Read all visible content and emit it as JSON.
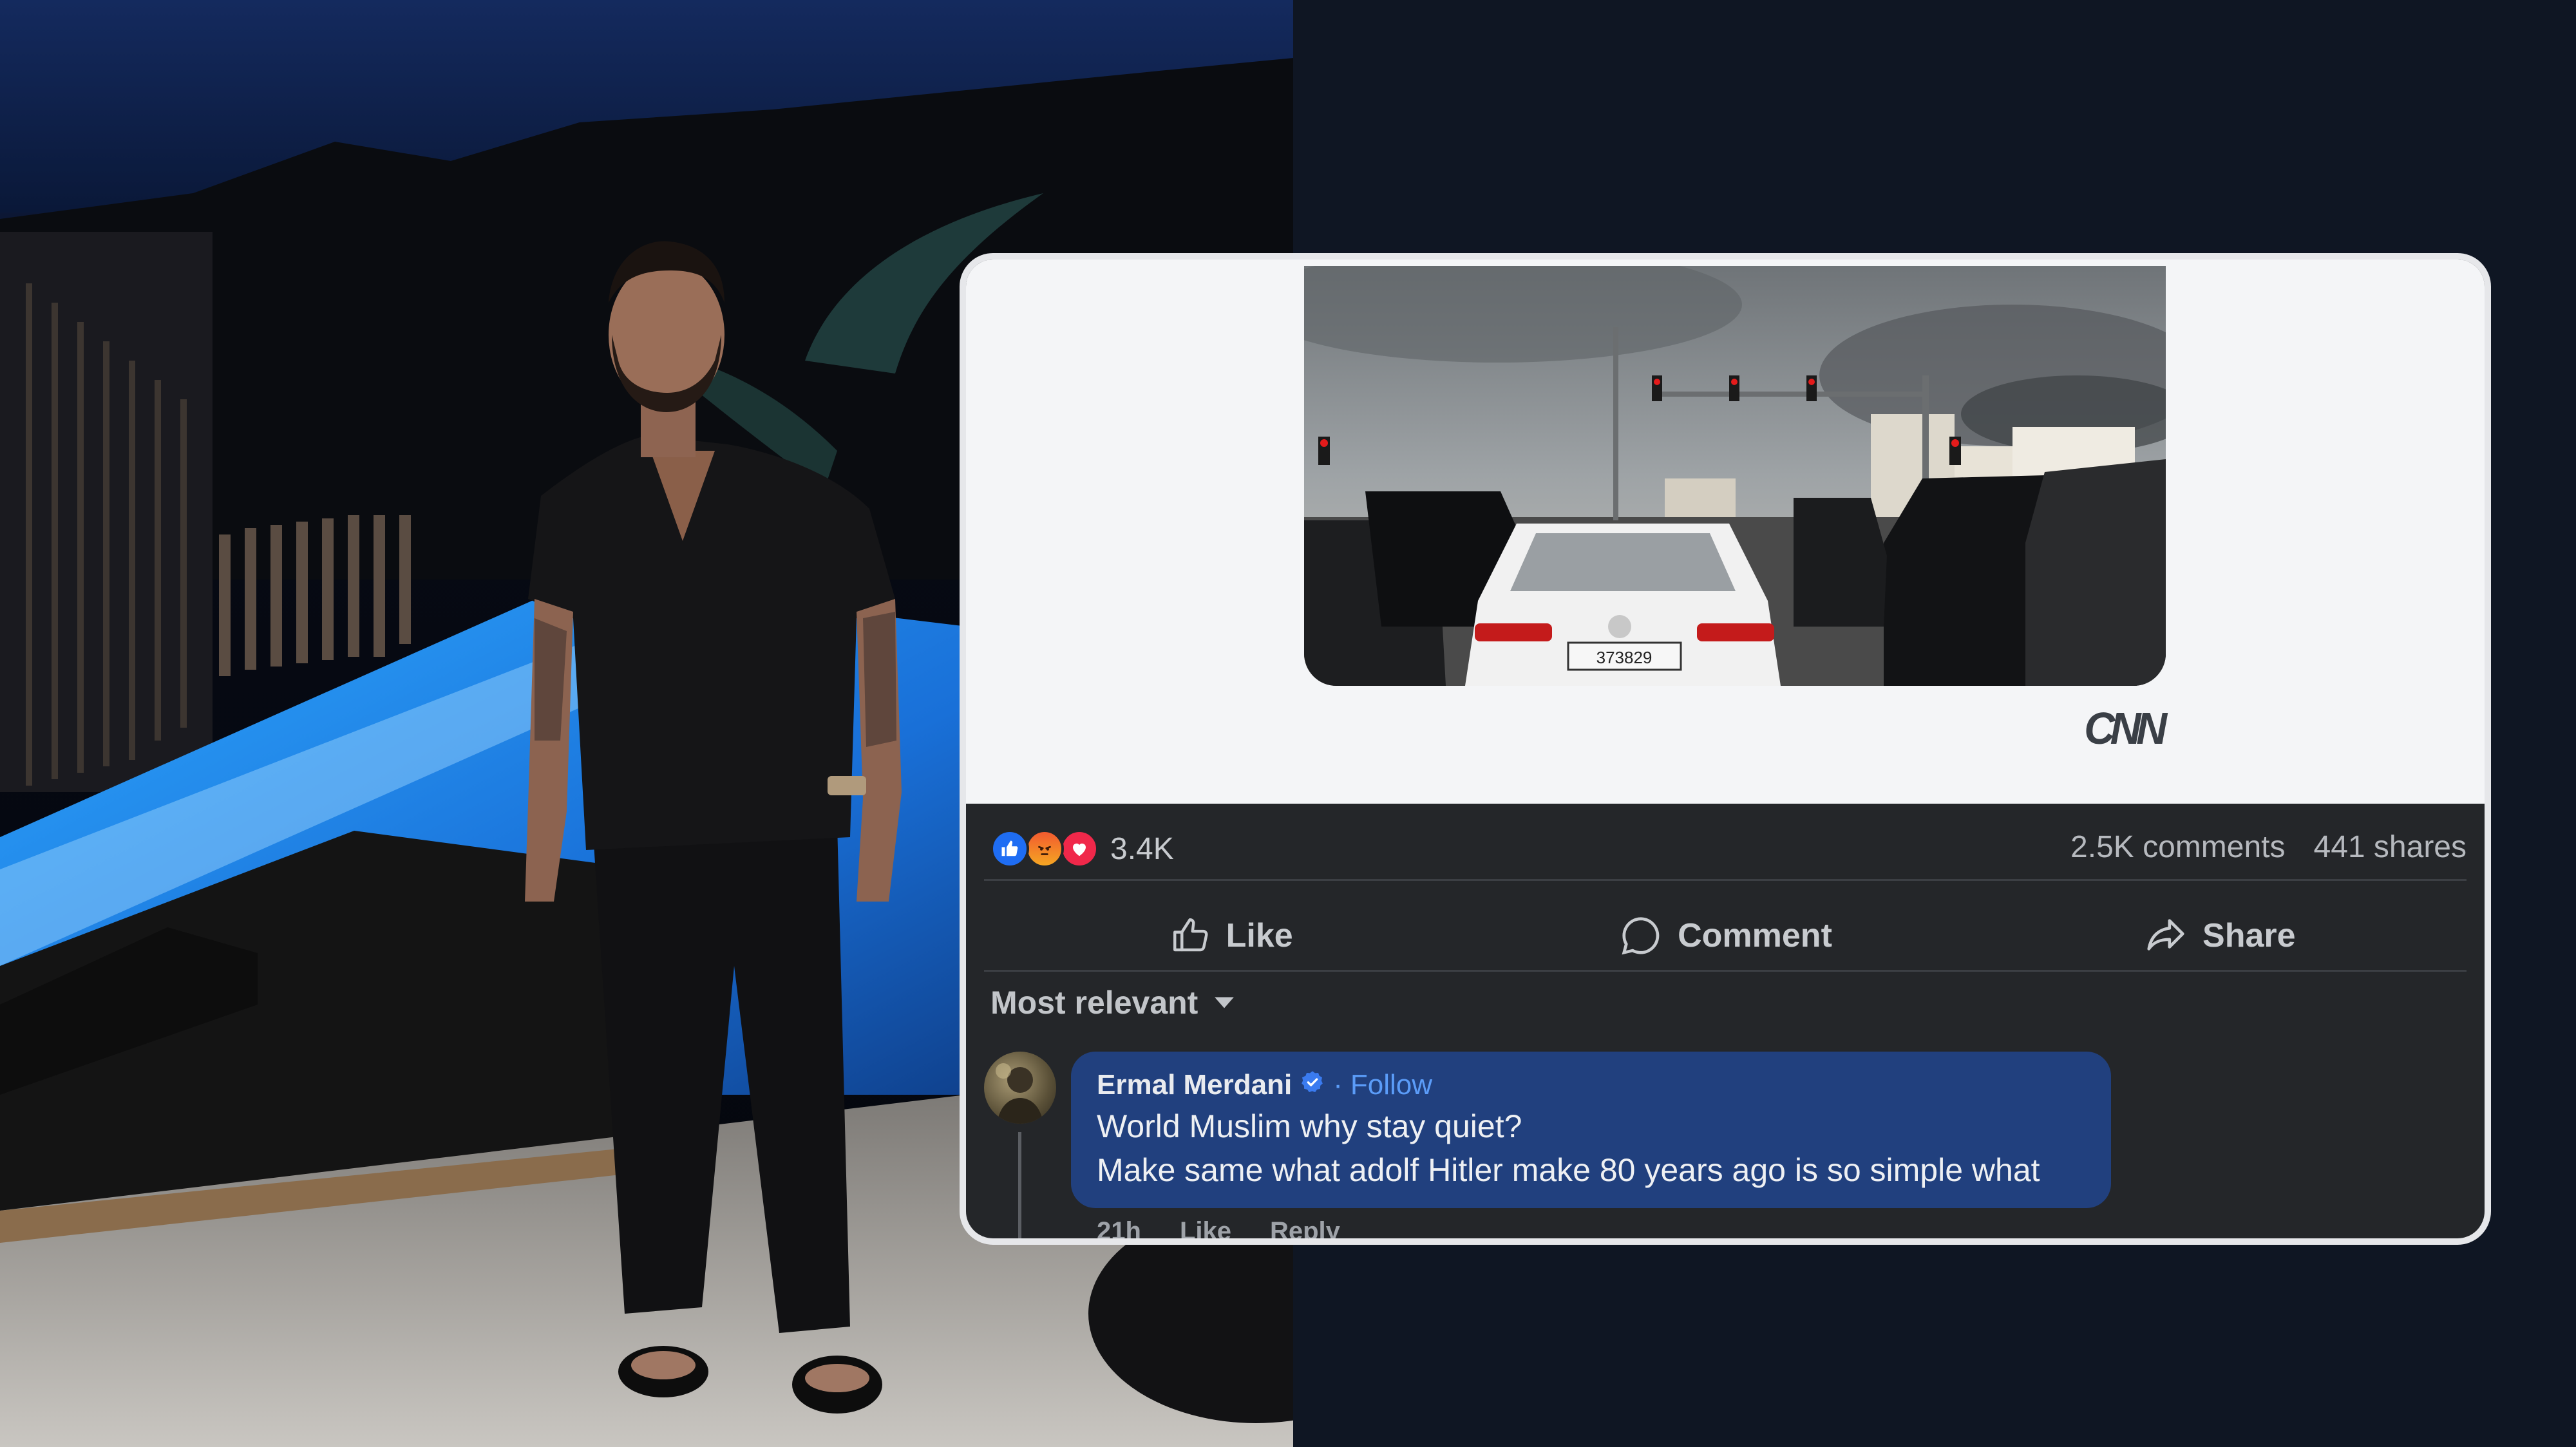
{
  "post": {
    "source_logo": "CNN",
    "plate_number": "373829",
    "reactions": {
      "types": [
        "like-icon",
        "angry-icon",
        "love-icon"
      ],
      "count": "3.4K"
    },
    "comments_count": "2.5K comments",
    "shares_count": "441 shares",
    "actions": {
      "like": "Like",
      "comment": "Comment",
      "share": "Share"
    },
    "sort_label": "Most relevant"
  },
  "comment": {
    "author": "Ermal Merdani",
    "follow_label": "Follow",
    "separator": "·",
    "lines": [
      "World Muslim why stay quiet?",
      "Make same what adolf Hitler make 80 years ago is so simple what"
    ],
    "time": "21h",
    "like_label": "Like",
    "reply_label": "Reply"
  },
  "colors": {
    "background": "#0f1623",
    "card_dark": "#242629",
    "card_light": "#f4f5f7",
    "bubble": "#21407e",
    "follow_link": "#5b9cf8",
    "like_blue": "#1f6df3"
  }
}
